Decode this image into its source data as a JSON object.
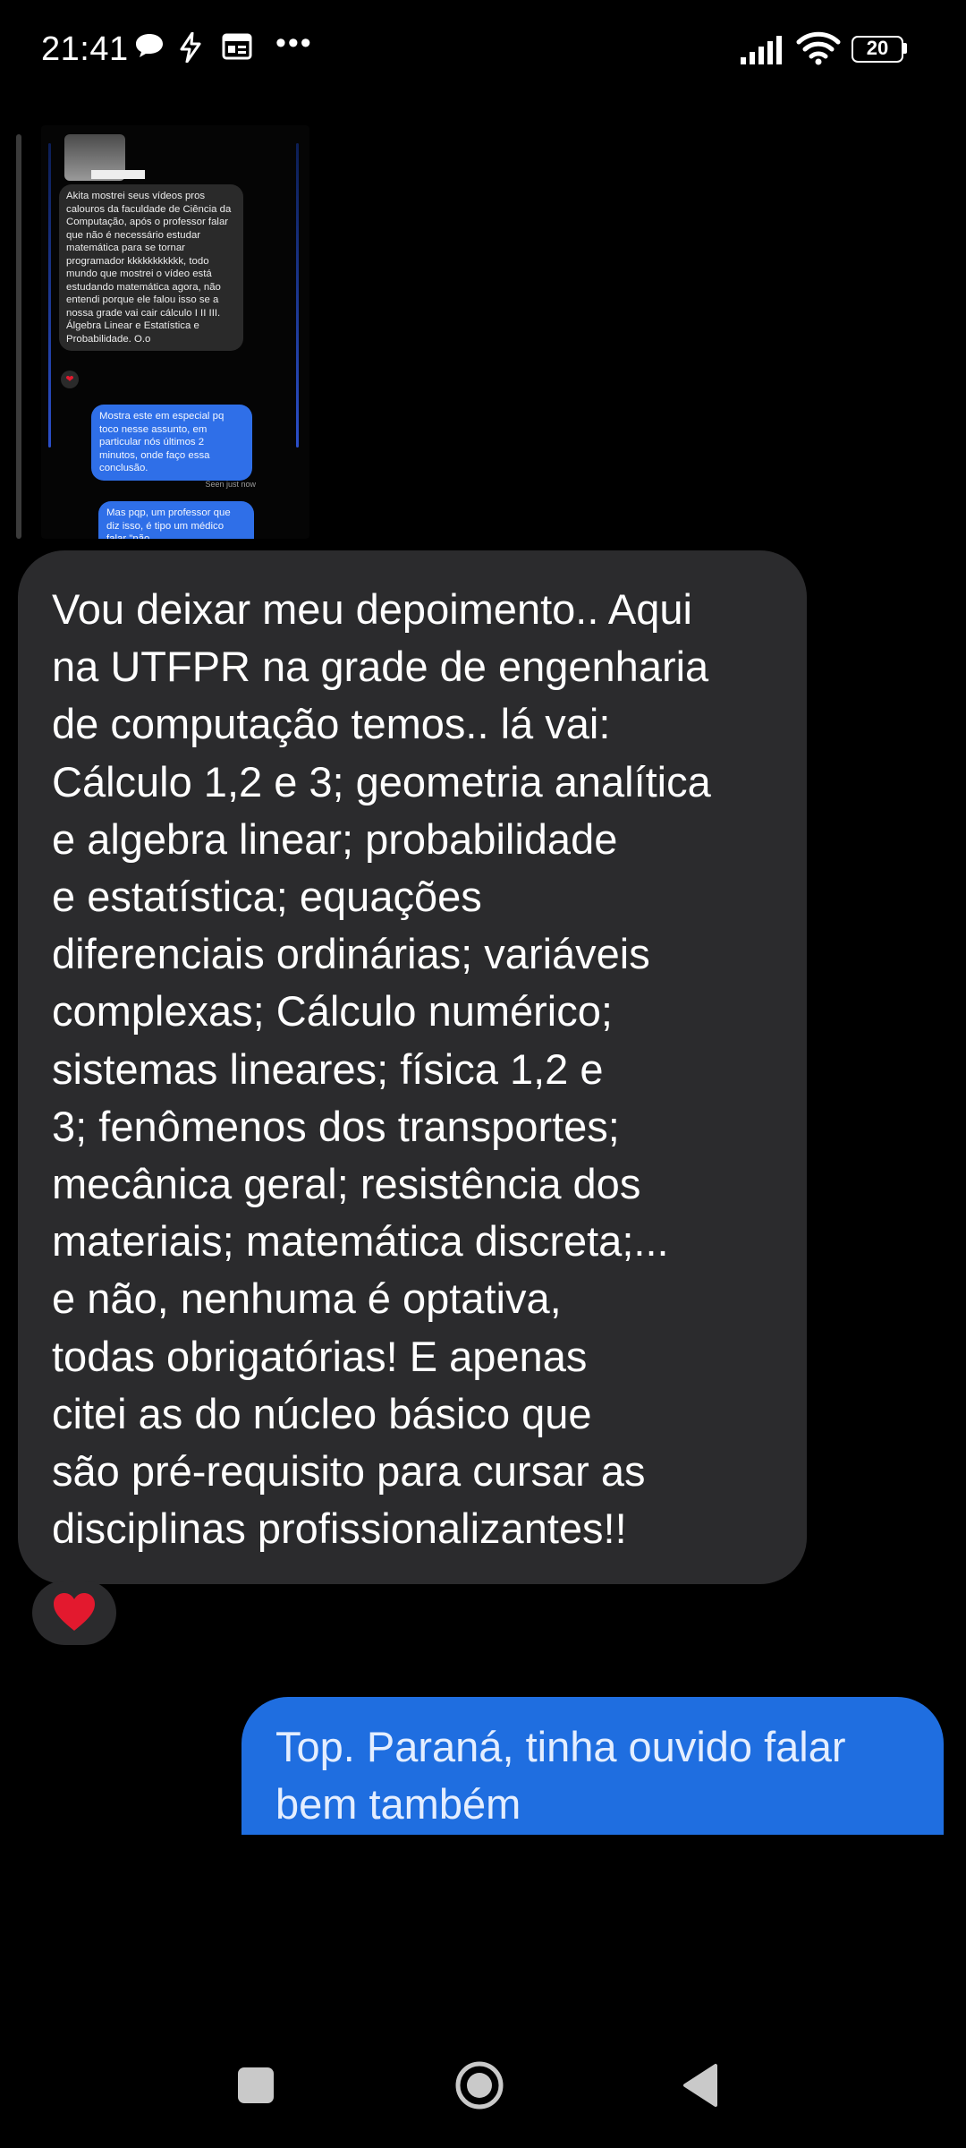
{
  "status_bar": {
    "time": "21:41",
    "battery": "20",
    "icons": [
      "chat-bubble-icon",
      "flash-icon",
      "news-icon",
      "more-dots-icon",
      "signal-icon",
      "wifi-icon",
      "battery-icon"
    ]
  },
  "quoted_screenshot": {
    "thumbnail_caption": "",
    "incoming_message": "Akita mostrei seus vídeos pros calouros da faculdade de Ciência da Computação, após o professor falar que não é necessário estudar matemática para se tornar programador kkkkkkkkkkk, todo mundo que mostrei o vídeo está estudando matemática agora, não entendi porque ele falou isso se a nossa grade vai cair cálculo I II III. Álgebra Linear e Estatística e Probabilidade. O.o",
    "outgoing_message_1": "Mostra este em especial pq toco nesse assunto, em particular nós últimos 2 minutos, onde faço essa conclusão.",
    "seen_status": "Seen just now",
    "outgoing_message_2": "Mas pqp, um professor que diz isso, é tipo um médico falar \"não"
  },
  "messages": [
    {
      "direction": "incoming",
      "text": "Vou deixar meu depoimento.. Aqui\nna UTFPR na grade de engenharia\nde computação temos.. lá vai:\nCálculo 1,2 e 3; geometria analítica\ne algebra linear; probabilidade\ne estatística; equações\ndiferenciais ordinárias; variáveis\ncomplexas; Cálculo numérico;\nsistemas lineares; física 1,2 e\n3; fenômenos dos transportes;\nmecânica geral; resistência dos\nmateriais; matemática discreta;...\ne não, nenhuma é optativa,\ntodas obrigatórias! E apenas\ncitei as do núcleo básico que\nsão pré-requisito para cursar as\ndisciplinas profissionalizantes!!",
      "reaction": "heart-icon"
    },
    {
      "direction": "outgoing",
      "text": "Top. Paraná, tinha ouvido falar\nbem também"
    }
  ],
  "nav_bar": {
    "buttons": [
      "recent-apps-button",
      "home-button",
      "back-button"
    ]
  },
  "colors": {
    "background": "#000000",
    "incoming_bubble": "#2b2b2d",
    "outgoing_bubble": "#1f6ee0",
    "heart": "#e3192e"
  }
}
